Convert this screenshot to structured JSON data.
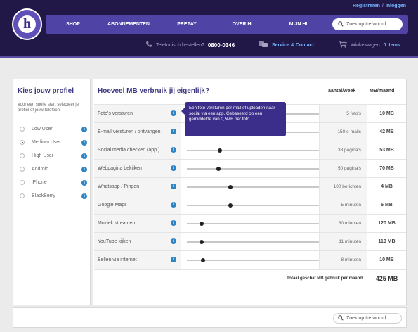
{
  "header": {
    "logo_letter": "h",
    "toplinks": {
      "register": "Registreren",
      "separator": "/",
      "login": "Inloggen"
    },
    "nav": [
      "SHOP",
      "ABONNEMENTEN",
      "PREPAY",
      "OVER HI",
      "MIJN HI"
    ],
    "search_placeholder": "Zoek op trefwoord",
    "phone_label": "Telefonisch bestellen?",
    "phone_number": "0800-0346",
    "service_link": "Service & Contact",
    "cart_label": "Winkelwagen",
    "cart_count": "0 items"
  },
  "sidebar": {
    "title": "Kies jouw profiel",
    "intro": "Voor een snelle start selecteer je profiel of jouw telefoon.",
    "profiles": [
      {
        "label": "Low User",
        "selected": false
      },
      {
        "label": "Medium User",
        "selected": true
      },
      {
        "label": "High User",
        "selected": false
      },
      {
        "label": "Android",
        "selected": false
      },
      {
        "label": "iPhone",
        "selected": false
      },
      {
        "label": "BlackBerry",
        "selected": false
      }
    ]
  },
  "main": {
    "title": "Hoeveel MB verbruik jij eigenlijk?",
    "col_per_week": "aantal/week",
    "col_mb_month": "MB/maand",
    "rows": [
      {
        "name": "Foto's versturen",
        "amount": "5 foto's",
        "mb": "10 MB",
        "slider": 0.03
      },
      {
        "name": "E-mail versturen / ontvangen",
        "amount": "150 e-mails",
        "mb": "42 MB",
        "slider": 0.08
      },
      {
        "name": "Social media checken (app.)",
        "amount": "38 pagina's",
        "mb": "53 MB",
        "slider": 0.25
      },
      {
        "name": "Webpagina bekijken",
        "amount": "50 pagina's",
        "mb": "70 MB",
        "slider": 0.24
      },
      {
        "name": "Whatsapp / Pingen",
        "amount": "100 berichten",
        "mb": "4 MB",
        "slider": 0.33
      },
      {
        "name": "Google Maps",
        "amount": "5 minuten",
        "mb": "6 MB",
        "slider": 0.33
      },
      {
        "name": "Muziek streamen",
        "amount": "30 minuten",
        "mb": "120 MB",
        "slider": 0.11
      },
      {
        "name": "YouTube kijken",
        "amount": "11 minuten",
        "mb": "110 MB",
        "slider": 0.11
      },
      {
        "name": "Bellen via internet",
        "amount": "8 minuten",
        "mb": "10 MB",
        "slider": 0.12
      }
    ],
    "total_label": "Totaal geschat MB gebruik per maand",
    "total_value": "425 MB",
    "tooltip": "Een foto versturen per mail of uploaden naar social via een app. Gebaseerd op een gemiddelde van 0,5MB per foto."
  },
  "footer": {
    "search_placeholder": "Zoek op trefwoord"
  },
  "colors": {
    "header_bg": "#221848",
    "nav_bg": "#5043a6",
    "accent_link": "#74b4ff",
    "info_blue": "#2c84c4",
    "title_purple": "#3c3780"
  }
}
